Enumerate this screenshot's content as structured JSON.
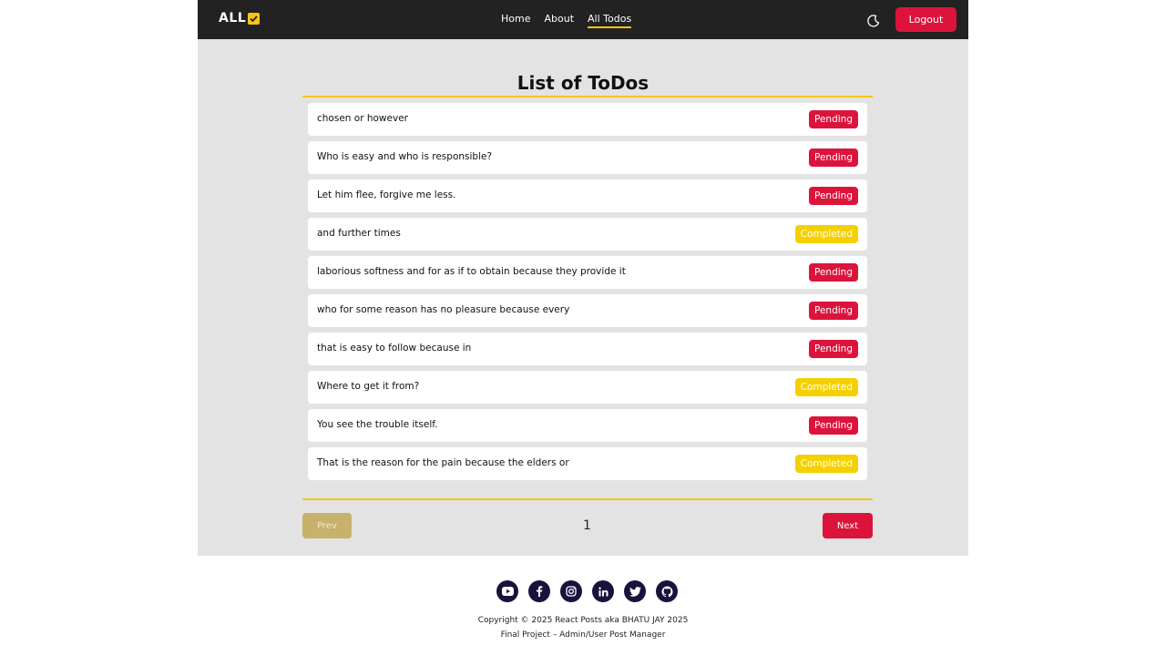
{
  "header": {
    "logo_text": "ALL",
    "nav": [
      {
        "label": "Home",
        "active": false
      },
      {
        "label": "About",
        "active": false
      },
      {
        "label": "All Todos",
        "active": true
      }
    ],
    "theme_icon": "moon-icon",
    "logout_label": "Logout"
  },
  "main": {
    "title": "List of ToDos",
    "todos": [
      {
        "text": "chosen or however",
        "status": "Pending"
      },
      {
        "text": "Who is easy and who is responsible?",
        "status": "Pending"
      },
      {
        "text": "Let him flee, forgive me less.",
        "status": "Pending"
      },
      {
        "text": "and further times",
        "status": "Completed"
      },
      {
        "text": "laborious softness and for as if to obtain because they provide it",
        "status": "Pending"
      },
      {
        "text": "who for some reason has no pleasure because every",
        "status": "Pending"
      },
      {
        "text": "that is easy to follow because in",
        "status": "Pending"
      },
      {
        "text": "Where to get it from?",
        "status": "Completed"
      },
      {
        "text": "You see the trouble itself.",
        "status": "Pending"
      },
      {
        "text": "That is the reason for the pain because the elders or",
        "status": "Completed"
      }
    ]
  },
  "pagination": {
    "prev_label": "Prev",
    "page": "1",
    "next_label": "Next"
  },
  "footer": {
    "social": [
      "youtube-icon",
      "facebook-icon",
      "instagram-icon",
      "linkedin-icon",
      "twitter-icon",
      "github-icon"
    ],
    "copyright": "Copyright © 2025 React Posts aka BHATU JAY 2025",
    "subtitle": "Final Project – Admin/User Post Manager"
  },
  "colors": {
    "header_bg": "#222222",
    "accent_red": "#dc143c",
    "accent_yellow": "#f5c518",
    "completed_yellow": "#f5d000",
    "content_bg": "#e3e3e3",
    "footer_icon_bg": "#17133d"
  }
}
